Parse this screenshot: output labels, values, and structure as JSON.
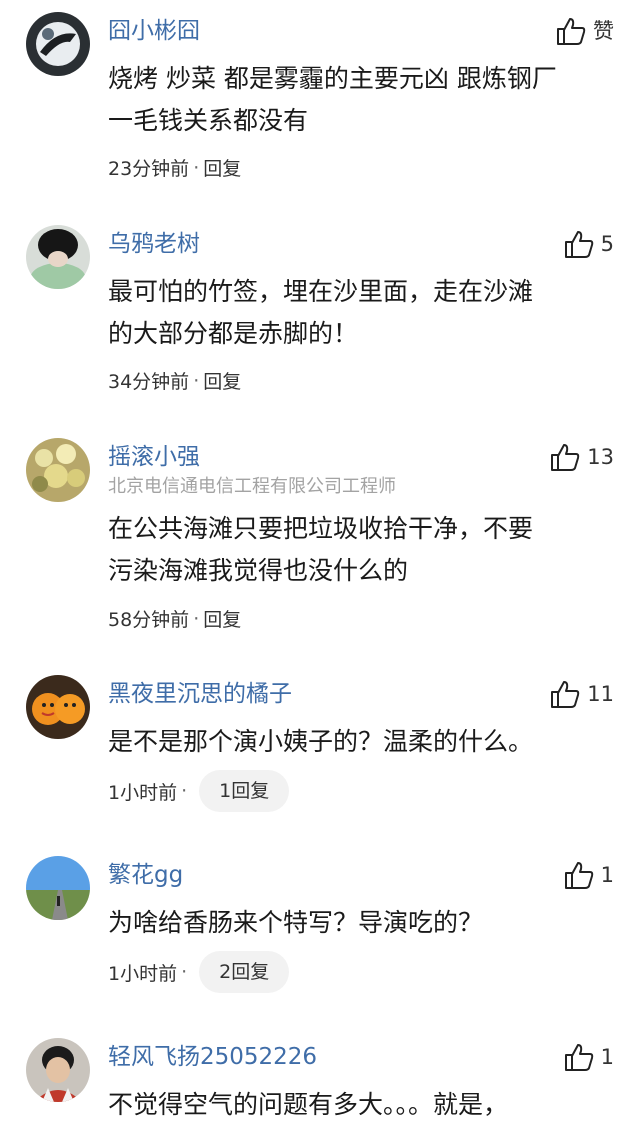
{
  "comments": [
    {
      "username": "囧小彬囧",
      "subtitle": "",
      "like_label": "赞",
      "text": "烧烤 炒菜 都是雾霾的主要元凶 跟炼钢厂\n一毛钱关系都没有",
      "time": "23分钟前",
      "reply": "回复",
      "avatar": "avatar-bird"
    },
    {
      "username": "乌鸦老树",
      "subtitle": "",
      "like_label": "5",
      "text": "最可怕的竹签，埋在沙里面，走在沙滩\n的大部分都是赤脚的！",
      "time": "34分钟前",
      "reply": "回复",
      "avatar": "avatar-person-dark-hair"
    },
    {
      "username": "摇滚小强",
      "subtitle": "北京电信通电信工程有限公司工程师",
      "like_label": "13",
      "text": "在公共海滩只要把垃圾收拾干净，不要\n污染海滩我觉得也没什么的",
      "time": "58分钟前",
      "reply": "回复",
      "avatar": "avatar-flowers"
    },
    {
      "username": "黑夜里沉思的橘子",
      "subtitle": "",
      "like_label": "11",
      "text": "是不是那个演小姨子的？温柔的什么。",
      "time": "1小时前",
      "reply": "1回复",
      "avatar": "avatar-oranges"
    },
    {
      "username": "繁花gg",
      "subtitle": "",
      "like_label": "1",
      "text": "为啥给香肠来个特写？导演吃的？",
      "time": "1小时前",
      "reply": "2回复",
      "avatar": "avatar-road"
    },
    {
      "username": "轻风飞扬25052226",
      "subtitle": "",
      "like_label": "1",
      "text": "不觉得空气的问题有多大。。。就是，",
      "time": "",
      "reply": "",
      "avatar": "avatar-boy"
    }
  ],
  "icons": {
    "like": "thumbs-up-icon"
  },
  "colors": {
    "username": "#3f6da8",
    "subtitle": "#a3a3a3",
    "text": "#1a1a1a",
    "pill": "#f2f2f2"
  }
}
